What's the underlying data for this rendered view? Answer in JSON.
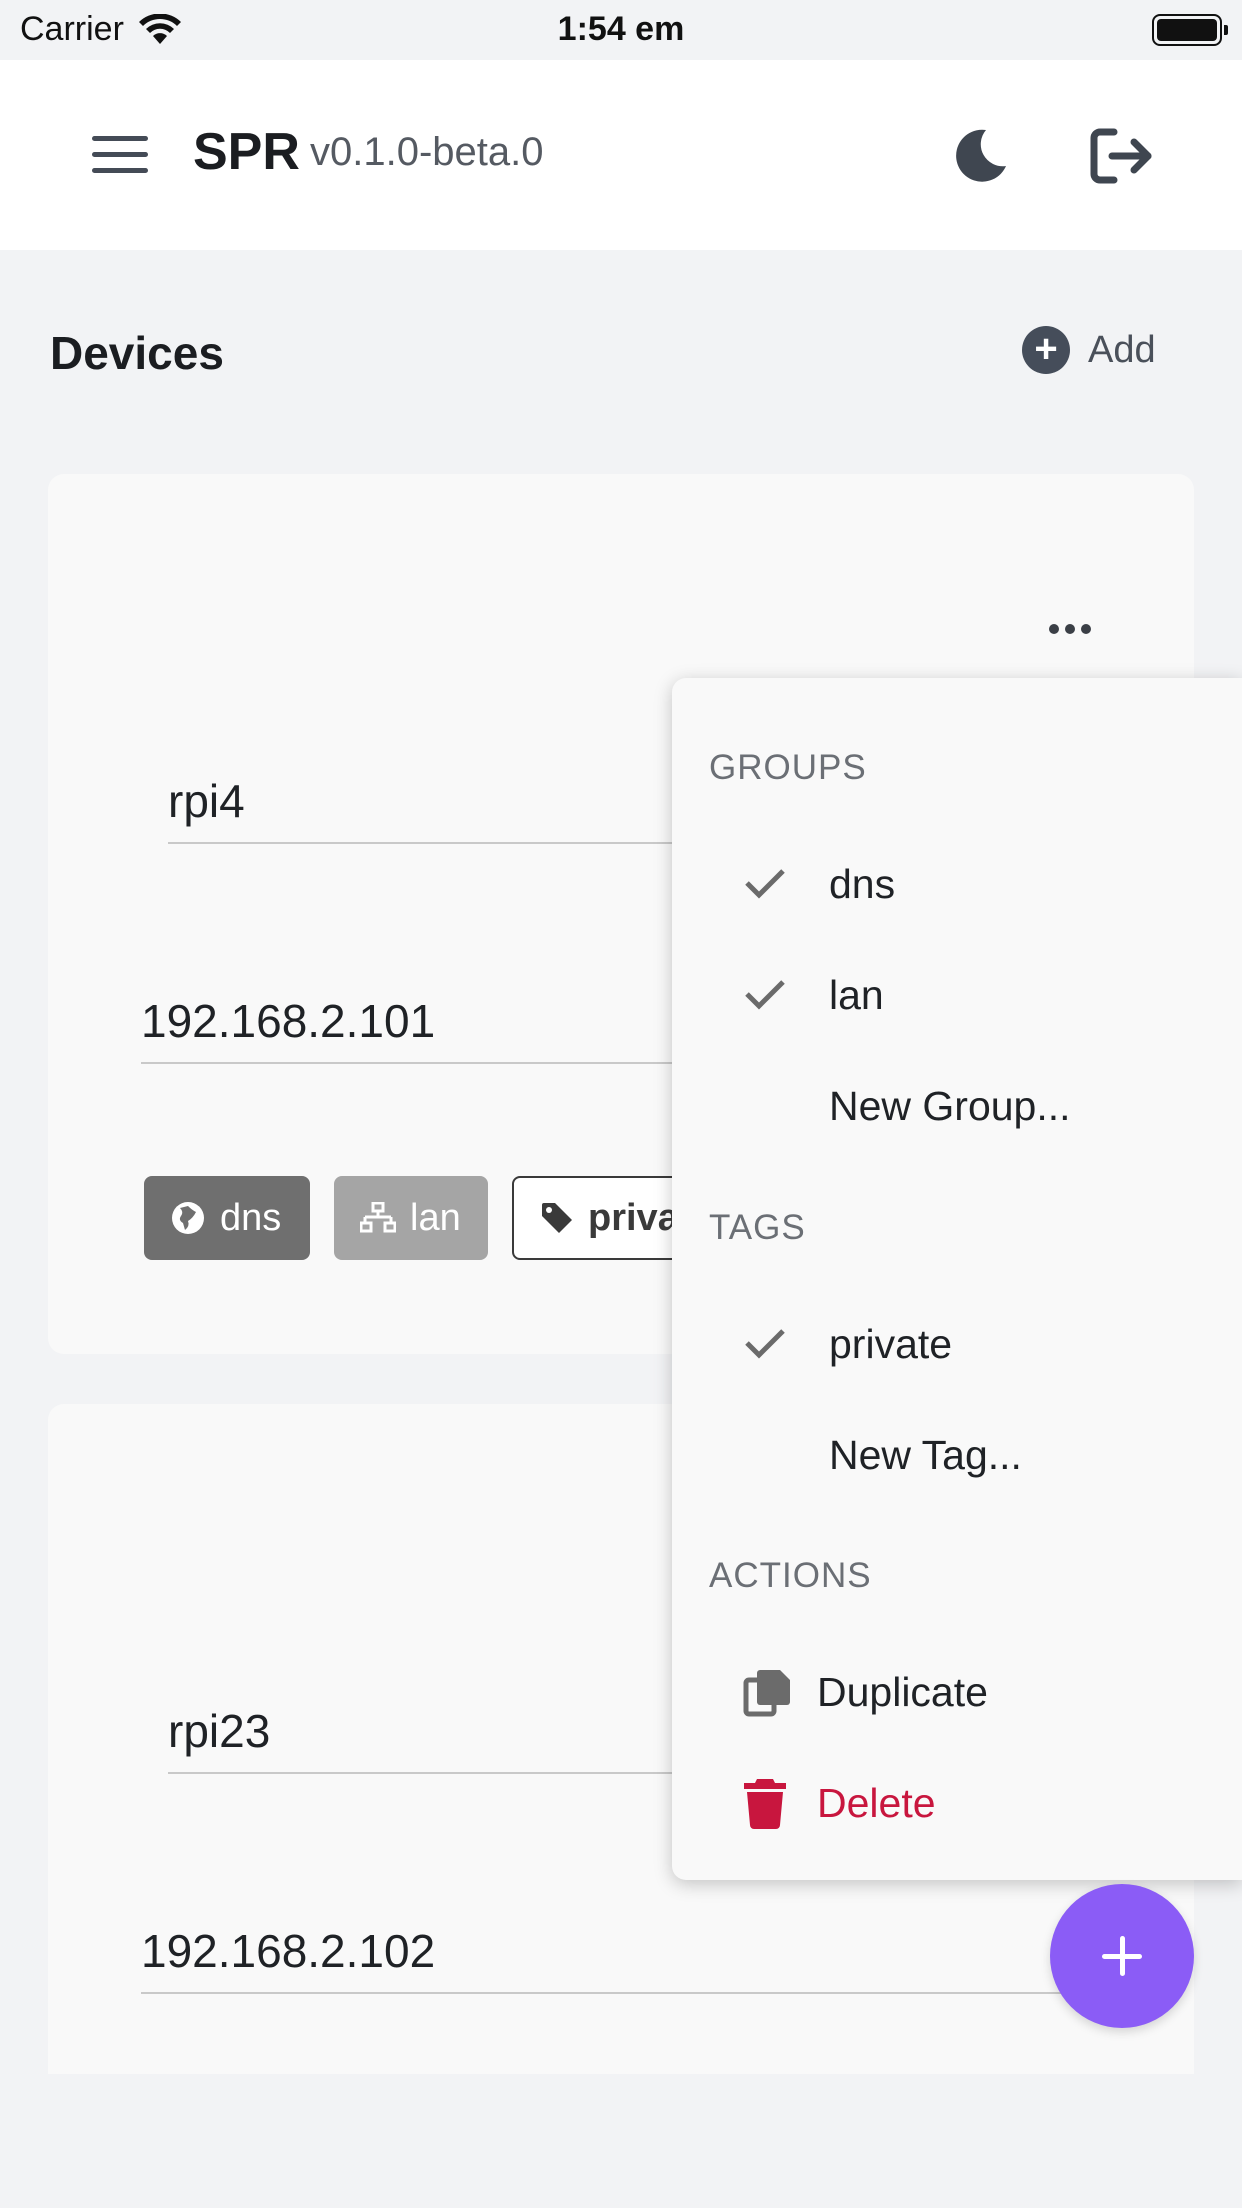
{
  "status_bar": {
    "carrier": "Carrier",
    "time": "1:54 em"
  },
  "header": {
    "title": "SPR",
    "version": "v0.1.0-beta.0"
  },
  "page": {
    "title": "Devices",
    "add_label": "Add"
  },
  "devices": [
    {
      "name": "rpi4",
      "ip": "192.168.2.101",
      "chips": {
        "dns": "dns",
        "lan": "lan",
        "tag": "priva"
      }
    },
    {
      "name": "rpi23",
      "ip": "192.168.2.102"
    }
  ],
  "menu": {
    "groups_header": "GROUPS",
    "groups": [
      {
        "label": "dns",
        "checked": true
      },
      {
        "label": "lan",
        "checked": true
      },
      {
        "label": "New Group...",
        "checked": false
      }
    ],
    "tags_header": "TAGS",
    "tags": [
      {
        "label": "private",
        "checked": true
      },
      {
        "label": "New Tag...",
        "checked": false
      }
    ],
    "actions_header": "ACTIONS",
    "actions": [
      {
        "label": "Duplicate",
        "icon": "duplicate-icon"
      },
      {
        "label": "Delete",
        "icon": "trash-icon"
      }
    ]
  },
  "colors": {
    "accent": "#8b5cf6",
    "danger": "#c8163e",
    "chip_dns": "#6f6f6f",
    "chip_lan": "#a5a5a5"
  }
}
